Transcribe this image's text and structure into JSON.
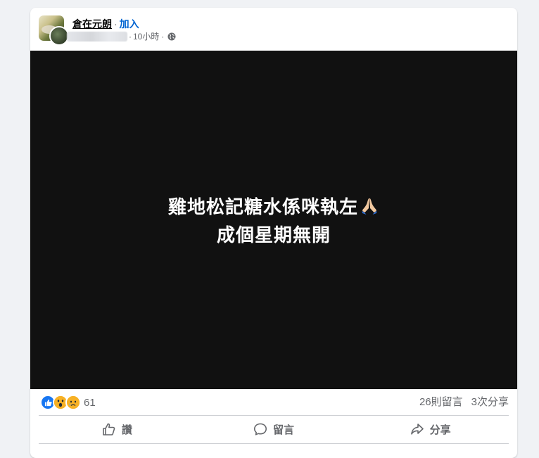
{
  "post": {
    "group_name": "倉在元朗",
    "separator": "·",
    "join_label": "加入",
    "time": "10小時",
    "time_separator": "·",
    "privacy_icon": "globe-icon",
    "media_text": {
      "line1": "雞地松記糖水係咪執左",
      "line2": "成個星期無開",
      "emoji": "folded-hands"
    }
  },
  "stats": {
    "reaction_icons": [
      "like",
      "wow",
      "sad"
    ],
    "reaction_count": "61",
    "comments": "26則留言",
    "shares": "3次分享"
  },
  "actions": {
    "like_label": "讚",
    "comment_label": "留言",
    "share_label": "分享"
  },
  "colors": {
    "page_bg": "#f0f2f5",
    "card_bg": "#ffffff",
    "media_bg": "#111111",
    "link_blue": "#0064d1",
    "secondary_text": "#65676b",
    "like_blue": "#1877f2",
    "reaction_yellow": "#f7b125"
  }
}
